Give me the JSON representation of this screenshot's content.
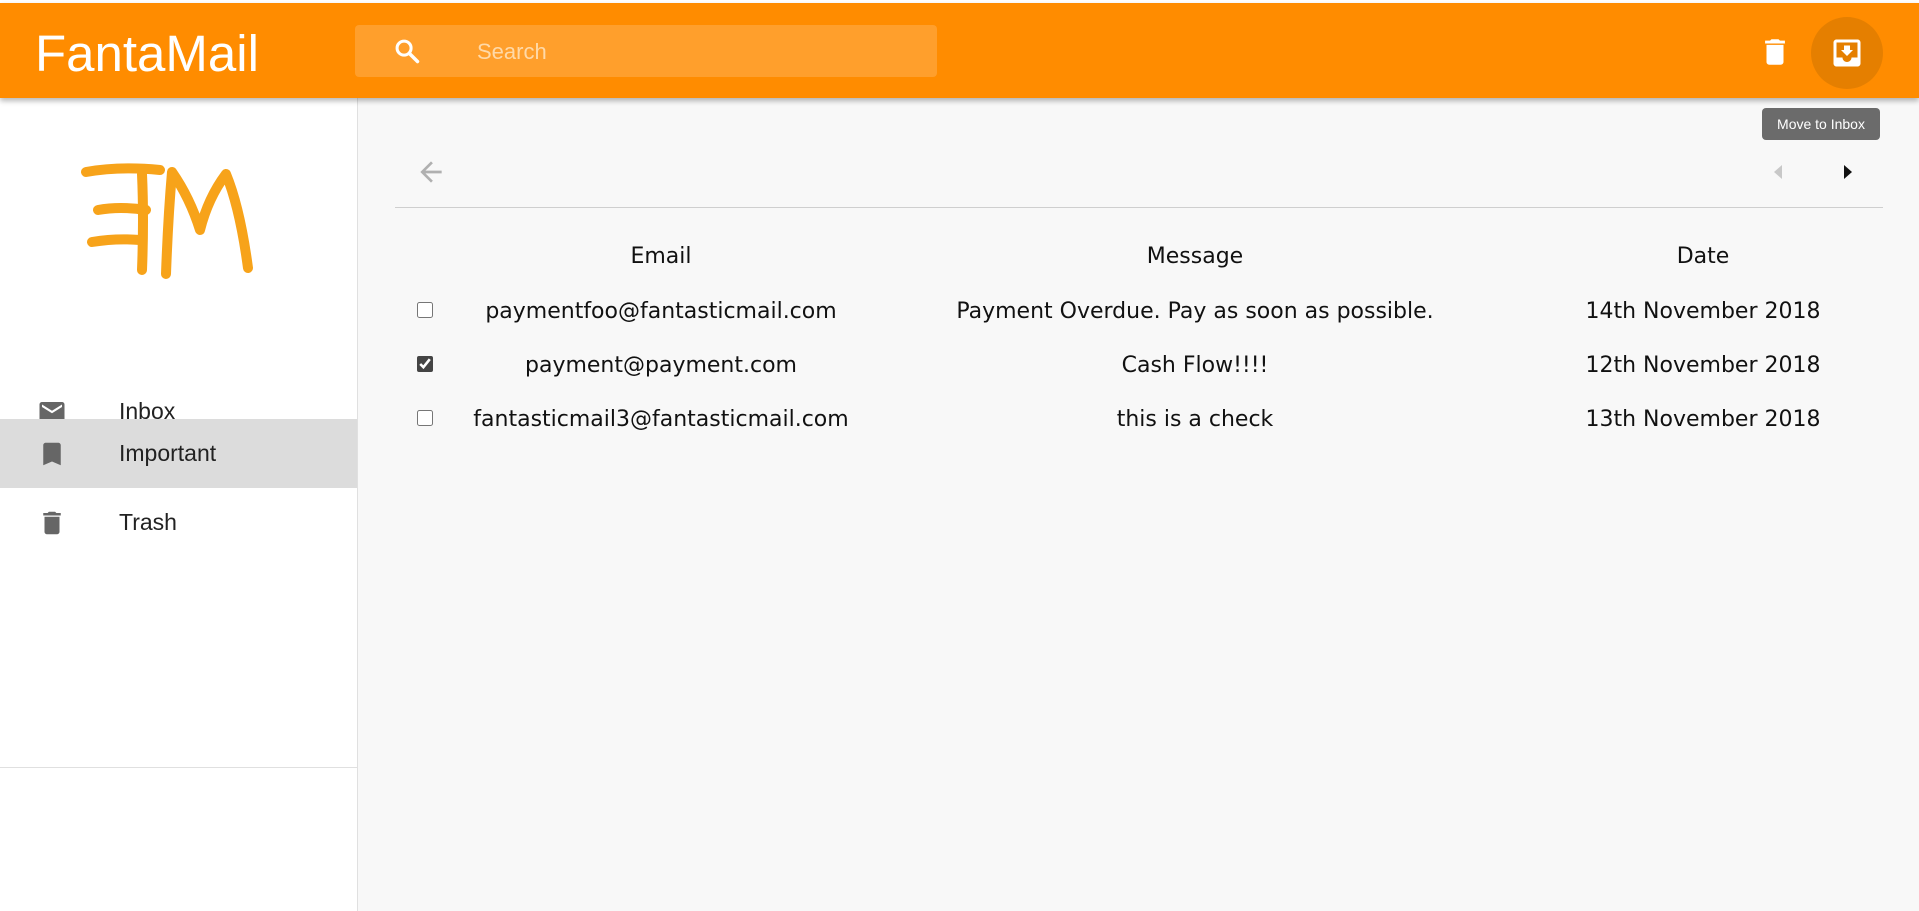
{
  "header": {
    "app_title": "FantaMail",
    "search_placeholder": "Search",
    "search_value": "",
    "delete_action": "delete-icon",
    "move_to_inbox_action": "move-to-inbox-icon",
    "tooltip": "Move to Inbox"
  },
  "sidebar": {
    "logo_text": "FM",
    "items": [
      {
        "label": "Inbox",
        "icon": "mail-icon",
        "active": false
      },
      {
        "label": "Important",
        "icon": "bookmark-icon",
        "active": true
      },
      {
        "label": "Trash",
        "icon": "trash-icon",
        "active": false
      }
    ]
  },
  "toolbar": {
    "back_icon": "arrow-back-icon",
    "prev_icon": "chevron-left-icon",
    "next_icon": "chevron-right-icon"
  },
  "table": {
    "columns": [
      "Email",
      "Message",
      "Date"
    ],
    "rows": [
      {
        "checked": false,
        "email": "paymentfoo@fantasticmail.com",
        "message": "Payment Overdue. Pay as soon as possible.",
        "date": "14th November 2018"
      },
      {
        "checked": true,
        "email": "payment@payment.com",
        "message": "Cash Flow!!!!",
        "date": "12th November 2018"
      },
      {
        "checked": false,
        "email": "fantasticmail3@fantasticmail.com",
        "message": "this is a check",
        "date": "13th November 2018"
      }
    ]
  },
  "colors": {
    "brand": "#ff8c00",
    "search_bg": "#ff9f2c",
    "active_nav_bg": "#dcdcdc",
    "logo": "#f7a31a"
  }
}
